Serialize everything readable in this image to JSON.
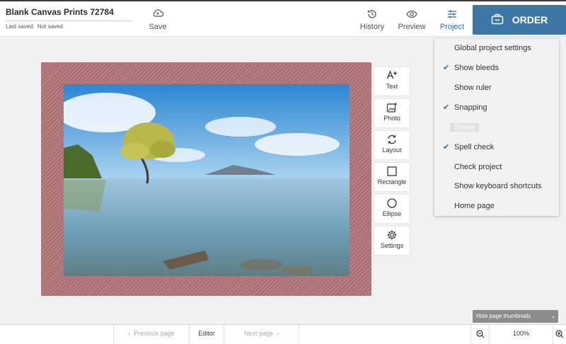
{
  "header": {
    "doc_title": "Blank Canvas Prints 72784",
    "last_saved_label": "Last saved:",
    "last_saved_value": "Not saved",
    "save_label": "Save",
    "history_label": "History",
    "preview_label": "Preview",
    "project_label": "Project",
    "order_label": "ORDER"
  },
  "tools": [
    {
      "label": "Text",
      "icon": "text-add-icon"
    },
    {
      "label": "Photo",
      "icon": "photo-add-icon"
    },
    {
      "label": "Layout",
      "icon": "layout-icon"
    },
    {
      "label": "Rectangle",
      "icon": "rectangle-icon"
    },
    {
      "label": "Ellipse",
      "icon": "ellipse-icon"
    },
    {
      "label": "Settings",
      "icon": "gear-icon"
    }
  ],
  "project_menu": {
    "items": [
      {
        "label": "Global project settings",
        "checked": false
      },
      {
        "label": "Show bleeds",
        "checked": true
      },
      {
        "label": "Show ruler",
        "checked": false
      },
      {
        "label": "Snapping",
        "checked": true
      },
      {
        "label": "Share",
        "checked": false,
        "disabled": true
      },
      {
        "label": "Spell check",
        "checked": true
      },
      {
        "label": "Check project",
        "checked": false
      },
      {
        "label": "Show keyboard shortcuts",
        "checked": false
      },
      {
        "label": "Home page",
        "checked": false
      }
    ]
  },
  "thumbs_toggle_label": "Hide page thumbnails",
  "footer": {
    "prev_label": "Previous page",
    "editor_label": "Editor",
    "next_label": "Next page",
    "zoom": "100%"
  },
  "colors": {
    "accent": "#3d77a6",
    "bleed": "#b27f83"
  }
}
